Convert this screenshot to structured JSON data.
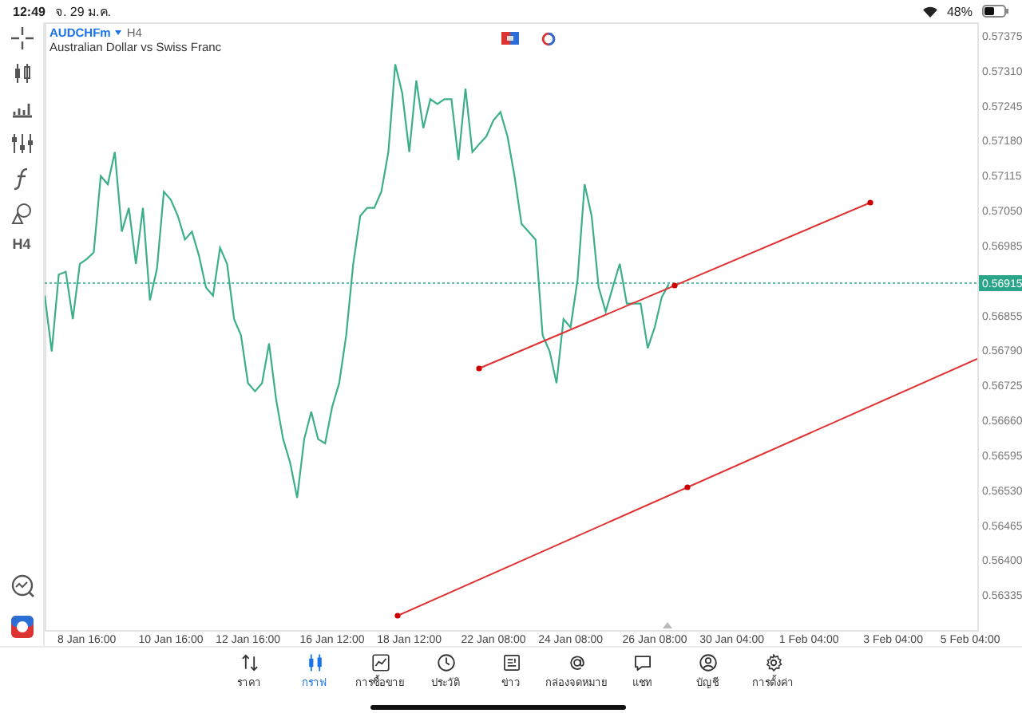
{
  "status_bar": {
    "time": "12:49",
    "date": "จ. 29 ม.ค.",
    "battery": "48%"
  },
  "toolbar": {
    "timeframe_button": "H4"
  },
  "chart": {
    "timeframe": "H4",
    "description": "Australian Dollar vs Swiss Franc",
    "chart_data": {
      "type": "line",
      "ylim": [
        0.5627,
        0.574
      ],
      "categories": [
        null,
        null,
        null,
        null,
        null,
        null,
        "8 Jan 16:00",
        null,
        null,
        null,
        null,
        null,
        null,
        null,
        null,
        null,
        null,
        null,
        "10 Jan 16:00",
        null,
        null,
        null,
        null,
        null,
        null,
        null,
        null,
        null,
        null,
        "12 Jan 16:00",
        null,
        null,
        null,
        null,
        null,
        null,
        null,
        null,
        null,
        null,
        null,
        "16 Jan 12:00",
        null,
        null,
        null,
        null,
        null,
        null,
        null,
        null,
        null,
        null,
        "18 Jan 12:00",
        null,
        null,
        null,
        null,
        null,
        null,
        null,
        null,
        null,
        null,
        null,
        "22 Jan 08:00",
        null,
        null,
        null,
        null,
        null,
        null,
        null,
        null,
        null,
        null,
        "24 Jan 08:00",
        null,
        null,
        null,
        null,
        null,
        null,
        null,
        null,
        null,
        null,
        null,
        "26 Jan 08:00",
        null,
        null,
        null,
        null,
        null,
        null,
        null,
        null,
        null,
        null,
        "30 Jan 04:00",
        null,
        null,
        null,
        null,
        null,
        null,
        null,
        null,
        null,
        null,
        "1 Feb 04:00",
        null,
        null,
        null,
        null,
        null,
        null,
        null,
        null,
        null,
        null,
        null,
        "3 Feb 04:00",
        null,
        null,
        null,
        null,
        null,
        null,
        null,
        null,
        null,
        null,
        "5 Feb 04:00",
        null
      ],
      "series": [
        {
          "name": "AUDCHFm",
          "color": "#3cae8c",
          "values": [
            0.56892,
            0.56788,
            0.56931,
            0.56936,
            0.56848,
            0.56951,
            0.5696,
            0.56972,
            0.57114,
            0.57099,
            0.57159,
            0.57011,
            0.57055,
            0.56951,
            0.57055,
            0.56883,
            0.56942,
            0.57085,
            0.5707,
            0.5704,
            0.56996,
            0.57011,
            0.56966,
            0.56907,
            0.56892,
            0.56981,
            0.56951,
            0.56848,
            0.56818,
            0.56729,
            0.56714,
            0.56729,
            0.56803,
            0.56699,
            0.56625,
            0.56581,
            0.56516,
            0.56625,
            0.56676,
            0.56625,
            0.56617,
            0.56685,
            0.56729,
            0.56818,
            0.56951,
            0.5704,
            0.57055,
            0.57055,
            0.57085,
            0.57159,
            0.57322,
            0.57268,
            0.57159,
            0.57292,
            0.57203,
            0.57257,
            0.57248,
            0.57257,
            0.57257,
            0.57144,
            0.57277,
            0.57159,
            0.57174,
            0.57188,
            0.57218,
            0.57233,
            0.57188,
            0.57114,
            0.57025,
            0.57011,
            0.56996,
            0.56818,
            0.56788,
            0.56729,
            0.56848,
            0.56833,
            0.56922,
            0.57099,
            0.5704,
            0.56907,
            0.56862,
            0.56907,
            0.56951,
            0.56877,
            0.56877,
            0.56877,
            0.56794,
            0.56833,
            0.56889,
            0.56913,
            null,
            null,
            null,
            null,
            null,
            null,
            null,
            null,
            null,
            null,
            null,
            null,
            null,
            null,
            null,
            null,
            null,
            null,
            null,
            null,
            null,
            null,
            null,
            null,
            null,
            null,
            null,
            null,
            null,
            null,
            null,
            null,
            null,
            null,
            null,
            null,
            null,
            null,
            null,
            null,
            null,
            null,
            null,
            null
          ]
        }
      ],
      "yticks": [
        {
          "value": 0.57375,
          "label": "0.57375"
        },
        {
          "value": 0.5731,
          "label": "0.57310"
        },
        {
          "value": 0.57245,
          "label": "0.57245"
        },
        {
          "value": 0.5718,
          "label": "0.57180"
        },
        {
          "value": 0.57115,
          "label": "0.57115"
        },
        {
          "value": 0.5705,
          "label": "0.57050"
        },
        {
          "value": 0.56985,
          "label": "0.56985"
        },
        {
          "value": 0.56855,
          "label": "0.56855"
        },
        {
          "value": 0.5679,
          "label": "0.56790"
        },
        {
          "value": 0.56725,
          "label": "0.56725"
        },
        {
          "value": 0.5666,
          "label": "0.56660"
        },
        {
          "value": 0.56595,
          "label": "0.56595"
        },
        {
          "value": 0.5653,
          "label": "0.56530"
        },
        {
          "value": 0.56465,
          "label": "0.56465"
        },
        {
          "value": 0.564,
          "label": "0.56400"
        },
        {
          "value": 0.56335,
          "label": "0.56335"
        }
      ],
      "ref_lines": [
        {
          "axis": "y",
          "value": 0.56915,
          "label": "0.56915"
        }
      ]
    }
  },
  "tabs": [
    {
      "label": "ราคา",
      "selected": false
    },
    {
      "label": "กราฟ",
      "selected": true
    },
    {
      "label": "การซื้อขาย",
      "selected": false
    },
    {
      "label": "ประวัติ",
      "selected": false
    },
    {
      "label": "ข่าว",
      "selected": false
    },
    {
      "label": "กล่องจดหมาย",
      "selected": false
    },
    {
      "label": "แชท",
      "selected": false
    },
    {
      "label": "บัญชี",
      "selected": false
    },
    {
      "label": "การตั้งค่า",
      "selected": false
    }
  ]
}
